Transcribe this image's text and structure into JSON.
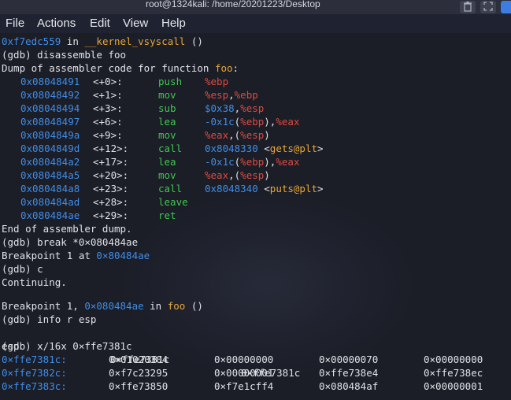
{
  "window": {
    "title": "root@1324kali: /home/20201223/Desktop"
  },
  "menu": [
    "File",
    "Actions",
    "Edit",
    "View",
    "Help"
  ],
  "colors": {
    "address": "#3f8ee8",
    "register": "#e04a3f",
    "opcode": "#3fc84f",
    "symbol": "#e8a838",
    "text": "#e1e3e8",
    "background": "#1b1d27"
  },
  "terminal": {
    "l0": {
      "addr": "0xf7edc559",
      "mid": " in ",
      "fn": "__kernel_vsyscall",
      "tail": " ()"
    },
    "l1": "(gdb) disassemble foo",
    "l2": {
      "pre": "Dump of assembler code for function ",
      "fn": "foo",
      "post": ":"
    },
    "disasm": [
      {
        "addr": "0x08048491",
        "off": "<+0>:",
        "op": "push",
        "args": [
          [
            "r",
            "%ebp"
          ]
        ]
      },
      {
        "addr": "0x08048492",
        "off": "<+1>:",
        "op": "mov",
        "args": [
          [
            "r",
            "%esp"
          ],
          [
            "w",
            ","
          ],
          [
            "r",
            "%ebp"
          ]
        ]
      },
      {
        "addr": "0x08048494",
        "off": "<+3>:",
        "op": "sub",
        "args": [
          [
            "b",
            "$0x38"
          ],
          [
            "w",
            ","
          ],
          [
            "r",
            "%esp"
          ]
        ]
      },
      {
        "addr": "0x08048497",
        "off": "<+6>:",
        "op": "lea",
        "args": [
          [
            "b",
            "-0x1c"
          ],
          [
            "w",
            "("
          ],
          [
            "r",
            "%ebp"
          ],
          [
            "w",
            "),"
          ],
          [
            "r",
            "%eax"
          ]
        ]
      },
      {
        "addr": "0x0804849a",
        "off": "<+9>:",
        "op": "mov",
        "args": [
          [
            "r",
            "%eax"
          ],
          [
            "w",
            ",("
          ],
          [
            "r",
            "%esp"
          ],
          [
            "w",
            ")"
          ]
        ]
      },
      {
        "addr": "0x0804849d",
        "off": "<+12>:",
        "op": "call",
        "args": [
          [
            "b",
            "0x8048330"
          ],
          [
            "w",
            " <"
          ],
          [
            "g",
            "gets@plt"
          ],
          [
            "w",
            ">"
          ]
        ]
      },
      {
        "addr": "0x080484a2",
        "off": "<+17>:",
        "op": "lea",
        "args": [
          [
            "b",
            "-0x1c"
          ],
          [
            "w",
            "("
          ],
          [
            "r",
            "%ebp"
          ],
          [
            "w",
            "),"
          ],
          [
            "r",
            "%eax"
          ]
        ]
      },
      {
        "addr": "0x080484a5",
        "off": "<+20>:",
        "op": "mov",
        "args": [
          [
            "r",
            "%eax"
          ],
          [
            "w",
            ",("
          ],
          [
            "r",
            "%esp"
          ],
          [
            "w",
            ")"
          ]
        ]
      },
      {
        "addr": "0x080484a8",
        "off": "<+23>:",
        "op": "call",
        "args": [
          [
            "b",
            "0x8048340"
          ],
          [
            "w",
            " <"
          ],
          [
            "g",
            "puts@plt"
          ],
          [
            "w",
            ">"
          ]
        ]
      },
      {
        "addr": "0x080484ad",
        "off": "<+28>:",
        "op": "leave",
        "args": []
      },
      {
        "addr": "0x080484ae",
        "off": "<+29>:",
        "op": "ret",
        "args": []
      }
    ],
    "l14": "End of assembler dump.",
    "l15": "(gdb) break *0×080484ae",
    "l16": {
      "pre": "Breakpoint 1 at ",
      "addr": "0×80484ae"
    },
    "l17": "(gdb) c",
    "l18": "Continuing.",
    "l20": {
      "pre": "Breakpoint 1, ",
      "addr": "0×080484ae",
      "mid": " in ",
      "fn": "foo",
      "post": " ()"
    },
    "l21": "(gdb) info r esp",
    "l22": {
      "reg": "esp",
      "hex": "0×ffe7381c",
      "dec": "0×ffe7381c"
    },
    "l23": "(gdb) x/16x 0×ffe7381c",
    "memory": [
      {
        "addr": "0×ffe7381c:",
        "words": [
          "0×01020304",
          "0×00000000",
          "0×00000070",
          "0×00000000"
        ]
      },
      {
        "addr": "0×ffe7382c:",
        "words": [
          "0×f7c23295",
          "0×00000001",
          "0×ffe738e4",
          "0×ffe738ec"
        ]
      },
      {
        "addr": "0×ffe7383c:",
        "words": [
          "0×ffe73850",
          "0×f7e1cff4",
          "0×080484af",
          "0×00000001"
        ]
      }
    ]
  }
}
